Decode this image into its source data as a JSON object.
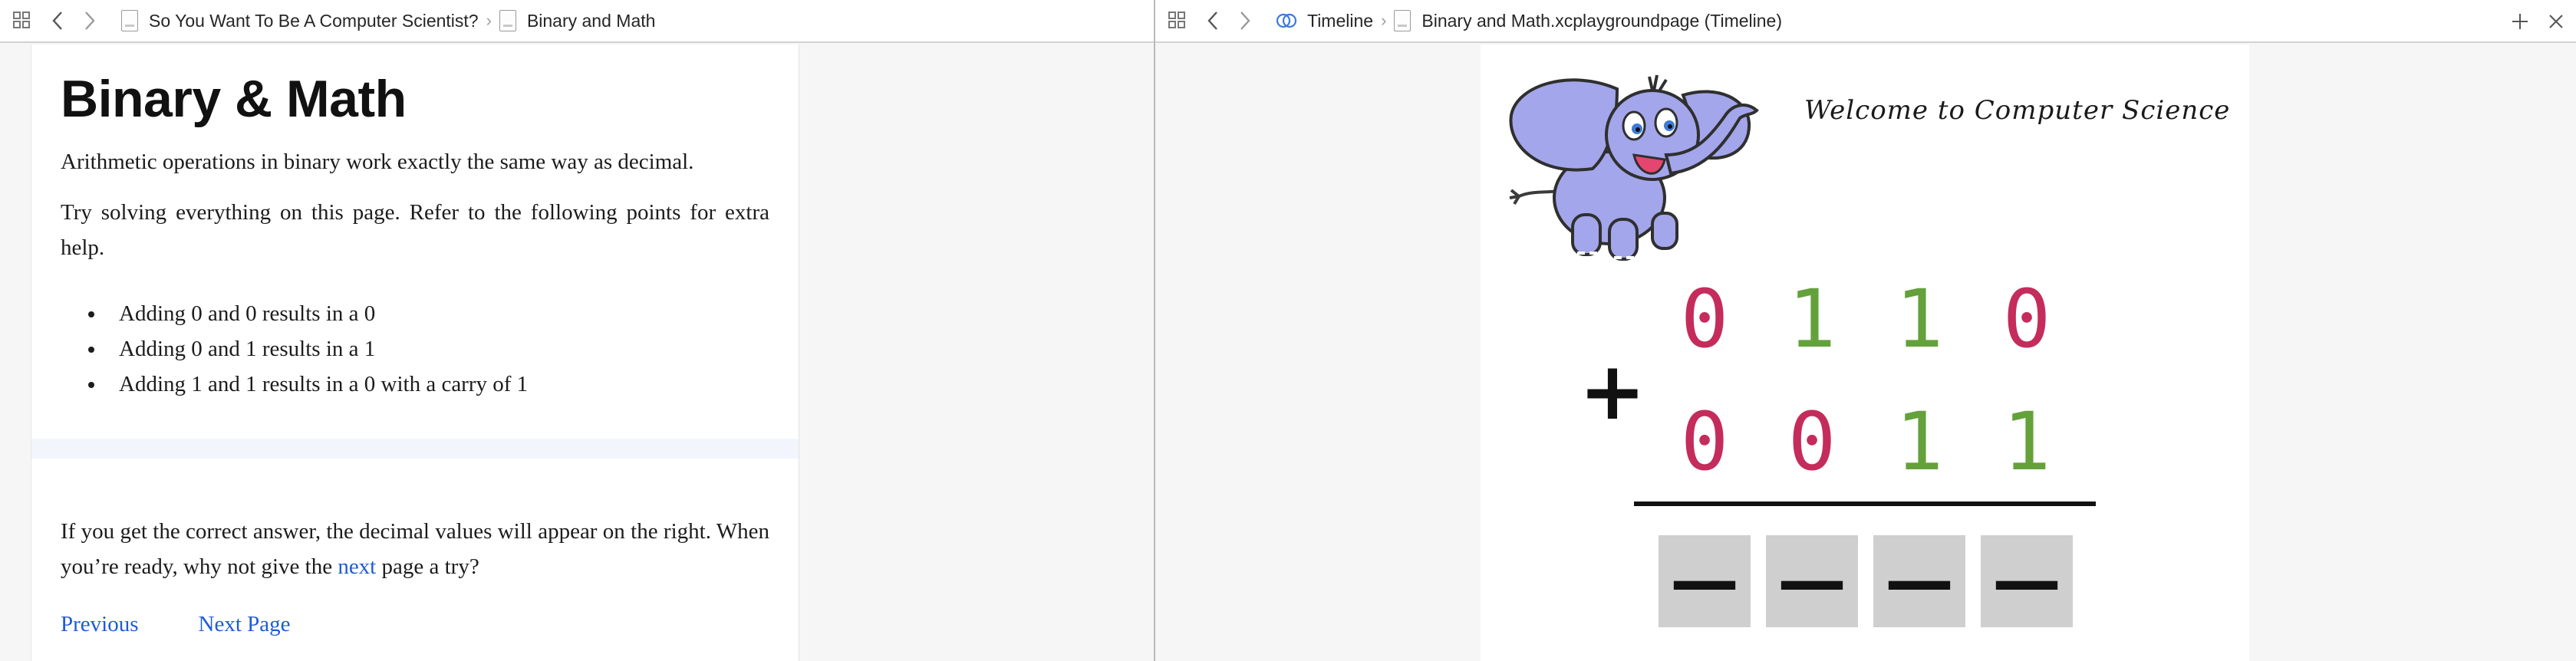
{
  "left_pane": {
    "jumpbar": {
      "breadcrumbs": [
        "So You Want To Be A Computer Scientist?",
        "Binary and Math"
      ],
      "separator": "›"
    },
    "doc": {
      "title": "Binary & Math",
      "intro": "Arithmetic operations in binary work exactly the same way as decimal.",
      "instruction": "Try solving everything on this page. Refer to the following points for extra help.",
      "bullets": [
        "Adding 0 and 0 results in a 0",
        "Adding 0 and 1 results in a 1",
        "Adding 1 and 1 results in a 0 with a carry of 1"
      ],
      "closing_before": "If you get the correct answer, the decimal values will appear on the right. When you’re ready, why not give the ",
      "closing_link": "next",
      "closing_after": " page a try?",
      "nav": {
        "previous": "Previous",
        "next_page": "Next Page"
      }
    }
  },
  "right_pane": {
    "jumpbar": {
      "breadcrumbs": [
        "Timeline",
        "Binary and Math.xcplaygroundpage (Timeline)"
      ],
      "separator": "›"
    },
    "live_view": {
      "welcome": "Welcome to Computer Science",
      "operator": "+",
      "row1": [
        {
          "value": "0",
          "color": "red"
        },
        {
          "value": "1",
          "color": "green"
        },
        {
          "value": "1",
          "color": "green"
        },
        {
          "value": "0",
          "color": "red"
        }
      ],
      "row2": [
        {
          "value": "0",
          "color": "red"
        },
        {
          "value": "0",
          "color": "red"
        },
        {
          "value": "1",
          "color": "green"
        },
        {
          "value": "1",
          "color": "green"
        }
      ],
      "answer_placeholder": "—",
      "answer_slots": 4
    }
  },
  "colors": {
    "digit_red": "#c42c5b",
    "digit_green": "#64a13b",
    "answer_box": "#cfcfcf",
    "link": "#1f5bd8",
    "elephant": "#a3a6ea"
  },
  "icons": [
    "grid-icon",
    "chevron-left-icon",
    "chevron-right-icon",
    "file-icon",
    "timeline-icon",
    "plus-icon",
    "close-icon"
  ]
}
